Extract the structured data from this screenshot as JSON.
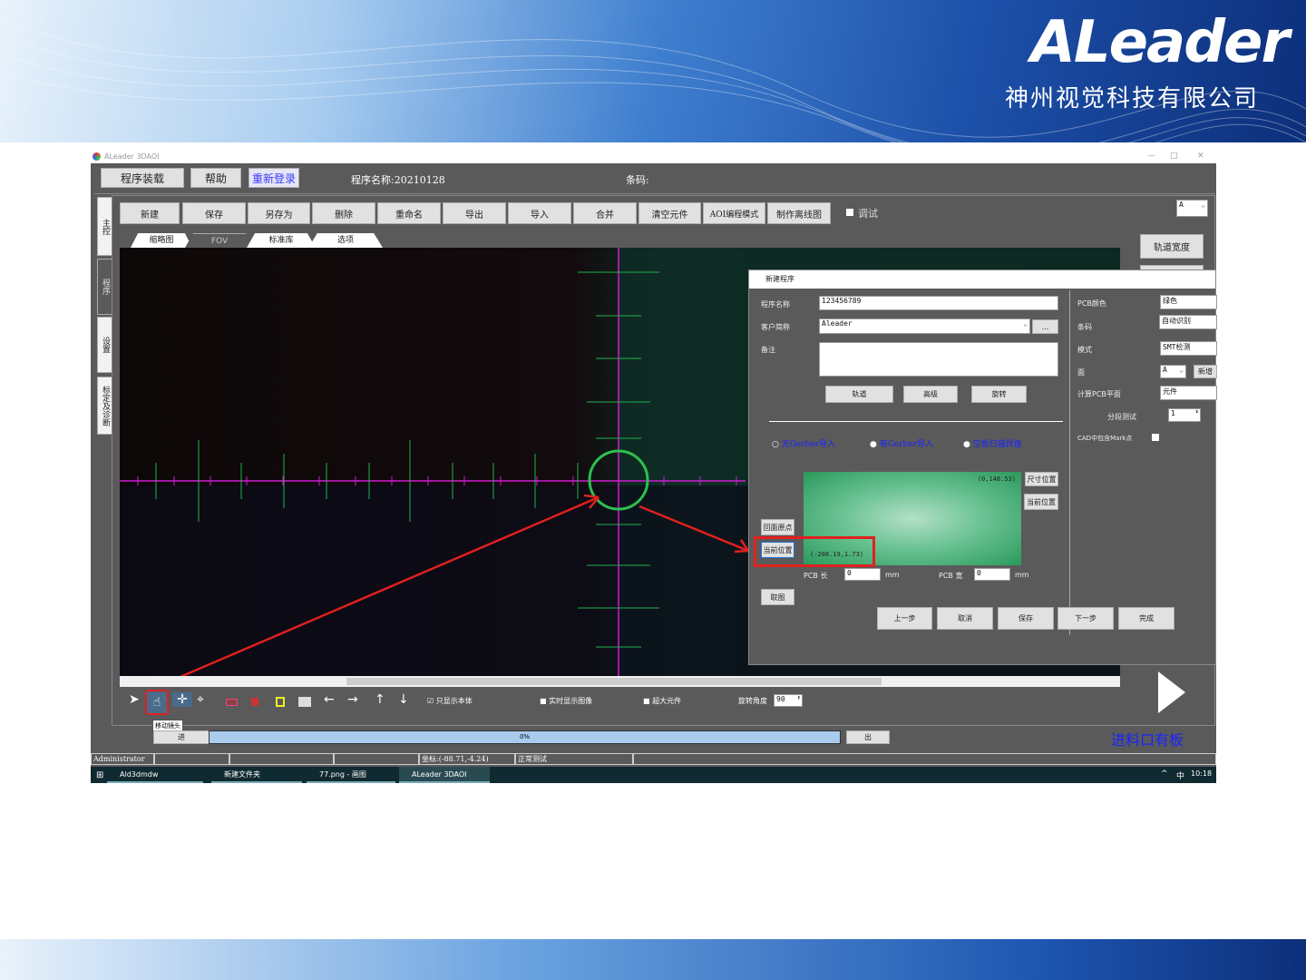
{
  "banner": {
    "logo": "ALeader",
    "company": "神州视觉科技有限公司"
  },
  "window": {
    "title": "ALeader 3DAOI",
    "controls": [
      "—",
      "□",
      "✕"
    ]
  },
  "topbar": {
    "load": "程序装载",
    "help": "帮助",
    "relogin": "重新登录",
    "program_name": "程序名称:20210128",
    "barcode": "条码:"
  },
  "side_tabs": [
    "主控",
    "程序",
    "设置",
    "标定及诊断"
  ],
  "toolbar": [
    "新建",
    "保存",
    "另存为",
    "删除",
    "重命名",
    "导出",
    "导入",
    "合并",
    "清空元件",
    "AOI编程模式",
    "制作离线图"
  ],
  "debug_label": "调试",
  "side_select": "A",
  "track_width": "轨道宽度",
  "view_tabs": [
    "缩略图",
    "FOV",
    "标准库",
    "选项"
  ],
  "tools": {
    "tooltip": "移动镜头",
    "only_body": "只显示本体",
    "realtime": "实时显示图像",
    "oversize": "超大元件",
    "rotate_label": "旋转角度",
    "rotate_value": "90"
  },
  "progress": {
    "in": "进",
    "out": "出",
    "value_text": "0%",
    "value": 0
  },
  "board_status": "进料口有板",
  "statusbar": {
    "user": "Administrator",
    "coords": "坐标:(-88.71,-4.24)",
    "mode": "正常测试"
  },
  "taskbar": {
    "items": [
      "Ald3dmdw",
      "新建文件夹",
      "77.png - 画图",
      "ALeader 3DAOI"
    ],
    "ime": "中",
    "time": "10:18"
  },
  "dialog": {
    "title": "新建程序",
    "program_name_label": "程序名称",
    "program_name": "123456789",
    "customer_label": "客户简称",
    "customer": "Aleader",
    "browse": "...",
    "note_label": "备注",
    "btn_track": "轨道",
    "btn_advanced": "高级",
    "btn_rotate": "旋转",
    "radios": [
      "无Gerber导入",
      "有Gerber导入",
      "空板扫描焊盘"
    ],
    "coord_top": "(0,148.53)",
    "coord_bottom": "(-208.19,1.73)",
    "size_pos": "尺寸位置",
    "current_pos_right": "当前位置",
    "origin": "回面原点",
    "current_pos": "当前位置",
    "capture": "取图",
    "pcb_len_label": "PCB 长",
    "pcb_len": "0",
    "pcb_wid_label": "PCB 宽",
    "pcb_wid": "0",
    "unit": "mm",
    "right": {
      "pcb_color_label": "PCB颜色",
      "pcb_color": "绿色",
      "barcode_label": "条码",
      "barcode": "自动识别",
      "mode_label": "模式",
      "mode": "SMT检测",
      "side_label": "面",
      "side": "A",
      "add": "新增",
      "plane_label": "计算PCB平面",
      "plane": "元件",
      "segment_label": "分段测试",
      "segment": "1",
      "mark_label": "CAD中包含Mark点"
    },
    "footer": [
      "上一步",
      "取消",
      "保存",
      "下一步",
      "完成"
    ]
  },
  "colors": {
    "accent_red": "#e0201f",
    "circle_green": "#2fbf4f",
    "app_bg": "#5a5a5a",
    "link_blue": "#1a24ff"
  }
}
